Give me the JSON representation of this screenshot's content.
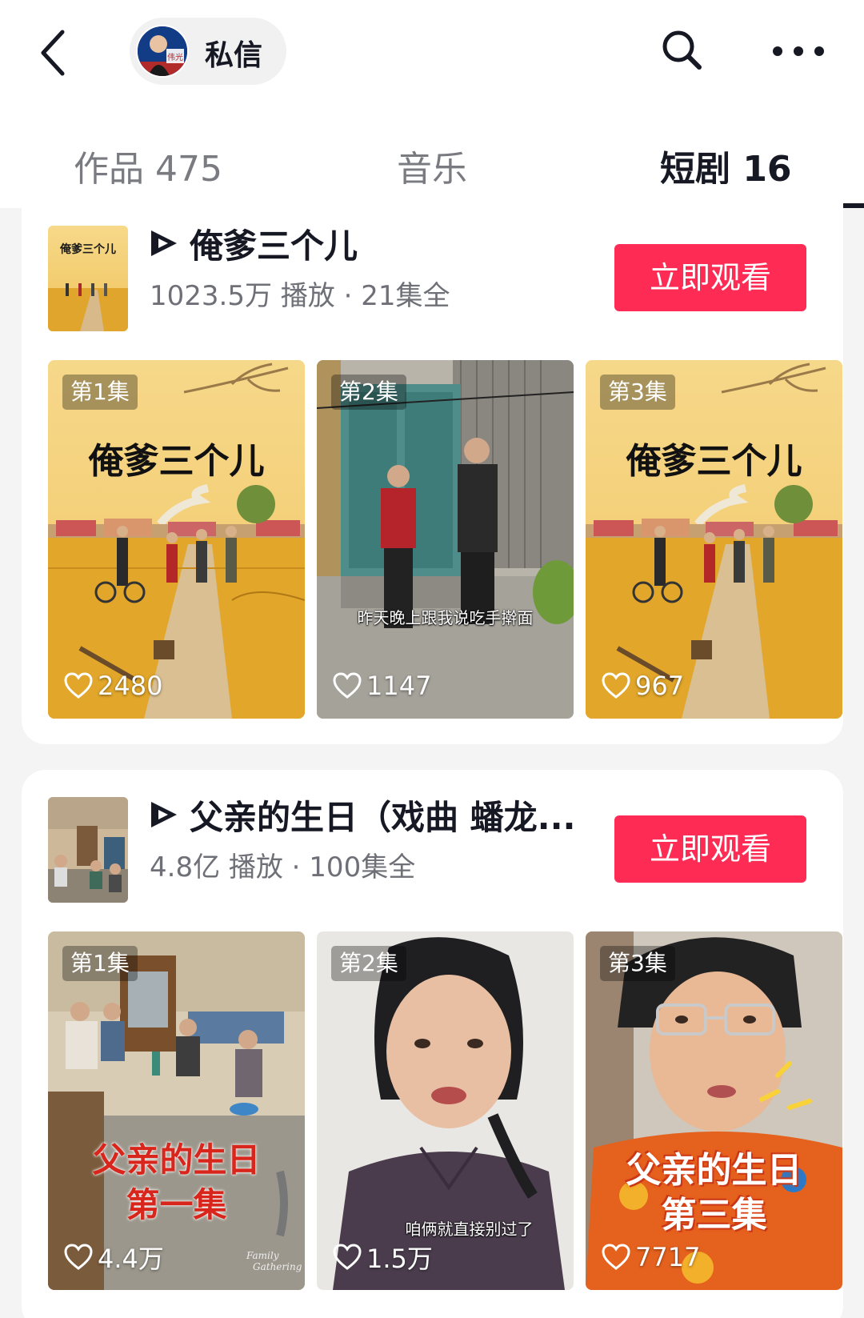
{
  "header": {
    "back_icon": "chevron-left-icon",
    "dm_label": "私信",
    "avatar_text": "伟光",
    "search_icon": "search-icon",
    "more_icon": "more-horizontal-icon"
  },
  "tabs": [
    {
      "label": "作品 475",
      "active": false
    },
    {
      "label": "音乐",
      "active": false
    },
    {
      "label": "短剧 16",
      "active": true
    }
  ],
  "series": [
    {
      "title": "俺爹三个儿",
      "stats": "1023.5万 播放 · 21集全",
      "watch_label": "立即观看",
      "thumb_text": "俺爹三个儿",
      "episodes": [
        {
          "badge": "第1集",
          "likes": "2480",
          "title": "俺爹三个儿"
        },
        {
          "badge": "第2集",
          "likes": "1147",
          "subtitle": "昨天晚上跟我说吃手擀面"
        },
        {
          "badge": "第3集",
          "likes": "967",
          "title": "俺爹三个儿"
        }
      ]
    },
    {
      "title": "父亲的生日（戏曲 蟠龙...",
      "stats": "4.8亿 播放 · 100集全",
      "watch_label": "立即观看",
      "episodes": [
        {
          "badge": "第1集",
          "likes": "4.4万",
          "poster_line1": "父亲的生日",
          "poster_line2": "第一集",
          "watermark_1": "Family",
          "watermark_2": "Gathering"
        },
        {
          "badge": "第2集",
          "likes": "1.5万",
          "subtitle": "咱俩就直接别过了"
        },
        {
          "badge": "第3集",
          "likes": "7717",
          "poster_line1": "父亲的生日",
          "poster_line2": "第三集"
        }
      ]
    }
  ],
  "colors": {
    "accent": "#fe2c55",
    "text_primary": "#161823",
    "text_secondary": "#6f7077"
  }
}
